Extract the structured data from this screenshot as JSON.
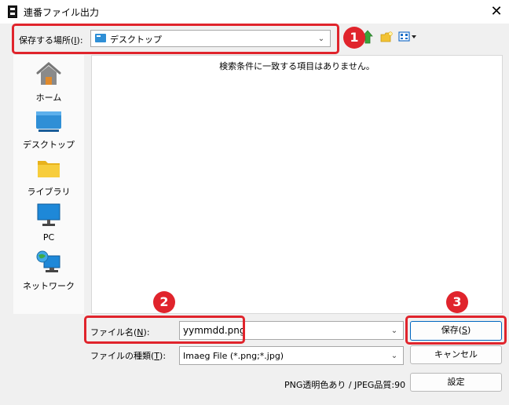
{
  "window": {
    "title": "連番ファイル出力",
    "close_icon": "close-icon"
  },
  "location": {
    "label": "保存する場所(I):",
    "value": "デスクトップ",
    "icon": "desktop-icon"
  },
  "toolbar": {
    "up_icon": "up-folder-icon",
    "new_folder_icon": "new-folder-icon",
    "view_menu_icon": "view-menu-icon"
  },
  "sidebar": {
    "items": [
      {
        "label": "ホーム",
        "icon": "home-icon"
      },
      {
        "label": "デスクトップ",
        "icon": "desktop-icon"
      },
      {
        "label": "ライブラリ",
        "icon": "library-folder-icon"
      },
      {
        "label": "PC",
        "icon": "pc-monitor-icon"
      },
      {
        "label": "ネットワーク",
        "icon": "network-icon"
      }
    ]
  },
  "file_list": {
    "empty_message": "検索条件に一致する項目はありません。"
  },
  "filename": {
    "label": "ファイル名(N):",
    "value": "yymmdd.png"
  },
  "filetype": {
    "label": "ファイルの種類(T):",
    "value": "Imaeg File (*.png;*.jpg)"
  },
  "buttons": {
    "save": "保存(S)",
    "cancel": "キャンセル",
    "settings": "設定"
  },
  "info_text": "PNG透明色あり / JPEG品質:90",
  "annotations": [
    "1",
    "2",
    "3"
  ],
  "colors": {
    "annotation": "#e0242c",
    "accent": "#0067c0",
    "desktop": "#2f8fd6"
  }
}
